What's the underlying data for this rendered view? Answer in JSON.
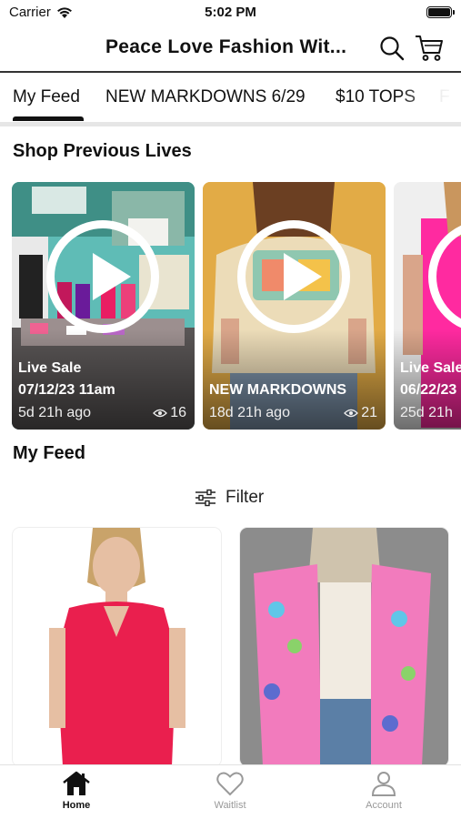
{
  "status_bar": {
    "carrier": "Carrier",
    "time": "5:02 PM"
  },
  "header": {
    "title": "Peace Love Fashion Wit..."
  },
  "tabs": [
    {
      "label": "My Feed",
      "active": true
    },
    {
      "label": "NEW MARKDOWNS 6/29"
    },
    {
      "label": "$10 TOPS"
    },
    {
      "label": "F"
    }
  ],
  "shop_previous": {
    "title": "Shop Previous Lives",
    "cards": [
      {
        "line1": "Live Sale",
        "line2": "07/12/23 11am",
        "ago": "5d 21h ago",
        "views": "16"
      },
      {
        "line1": "",
        "line2": "NEW MARKDOWNS",
        "ago": "18d 21h ago",
        "views": "21"
      },
      {
        "line1": "Live Sale",
        "line2": "06/22/23",
        "ago": "25d 21h",
        "views": ""
      }
    ]
  },
  "feed": {
    "title": "My Feed",
    "filter_label": "Filter"
  },
  "nav": {
    "home": "Home",
    "waitlist": "Waitlist",
    "account": "Account"
  },
  "colors": {
    "accent": "#111111",
    "inactive": "#999999",
    "pink": "#ff2aa0"
  }
}
